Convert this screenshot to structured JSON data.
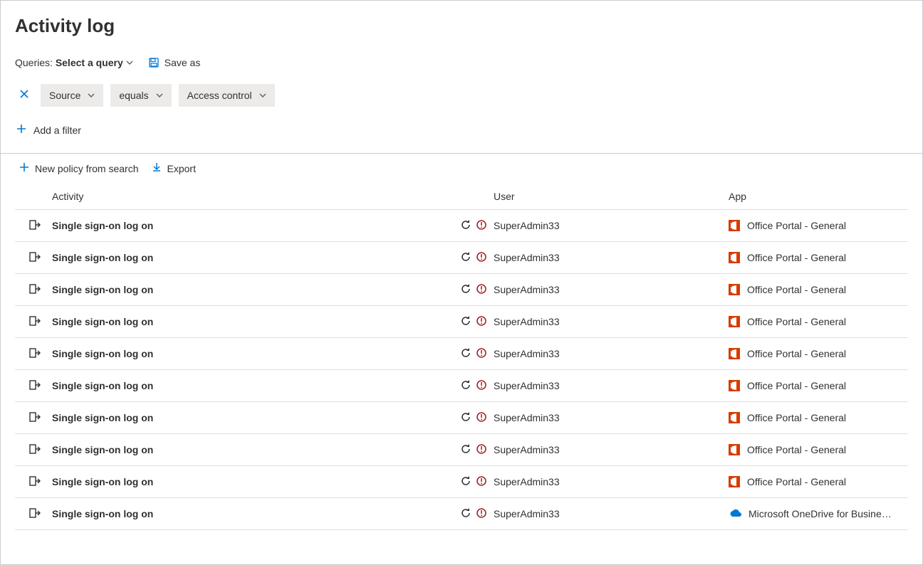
{
  "title": "Activity log",
  "queries": {
    "label": "Queries:",
    "select_label": "Select a query",
    "save_as_label": "Save as"
  },
  "filters": {
    "pills": [
      {
        "label": "Source"
      },
      {
        "label": "equals"
      },
      {
        "label": "Access control"
      }
    ],
    "add_filter_label": "Add a filter"
  },
  "actions": {
    "new_policy_label": "New policy from search",
    "export_label": "Export"
  },
  "table": {
    "headers": {
      "activity": "Activity",
      "user": "User",
      "app": "App"
    },
    "rows": [
      {
        "activity": "Single sign-on log on",
        "user": "SuperAdmin33",
        "app": "Office Portal - General",
        "app_icon": "office"
      },
      {
        "activity": "Single sign-on log on",
        "user": "SuperAdmin33",
        "app": "Office Portal - General",
        "app_icon": "office"
      },
      {
        "activity": "Single sign-on log on",
        "user": "SuperAdmin33",
        "app": "Office Portal - General",
        "app_icon": "office"
      },
      {
        "activity": "Single sign-on log on",
        "user": "SuperAdmin33",
        "app": "Office Portal - General",
        "app_icon": "office"
      },
      {
        "activity": "Single sign-on log on",
        "user": "SuperAdmin33",
        "app": "Office Portal - General",
        "app_icon": "office"
      },
      {
        "activity": "Single sign-on log on",
        "user": "SuperAdmin33",
        "app": "Office Portal - General",
        "app_icon": "office"
      },
      {
        "activity": "Single sign-on log on",
        "user": "SuperAdmin33",
        "app": "Office Portal - General",
        "app_icon": "office"
      },
      {
        "activity": "Single sign-on log on",
        "user": "SuperAdmin33",
        "app": "Office Portal - General",
        "app_icon": "office"
      },
      {
        "activity": "Single sign-on log on",
        "user": "SuperAdmin33",
        "app": "Office Portal - General",
        "app_icon": "office"
      },
      {
        "activity": "Single sign-on log on",
        "user": "SuperAdmin33",
        "app": "Microsoft OneDrive for Busine…",
        "app_icon": "onedrive"
      }
    ]
  }
}
